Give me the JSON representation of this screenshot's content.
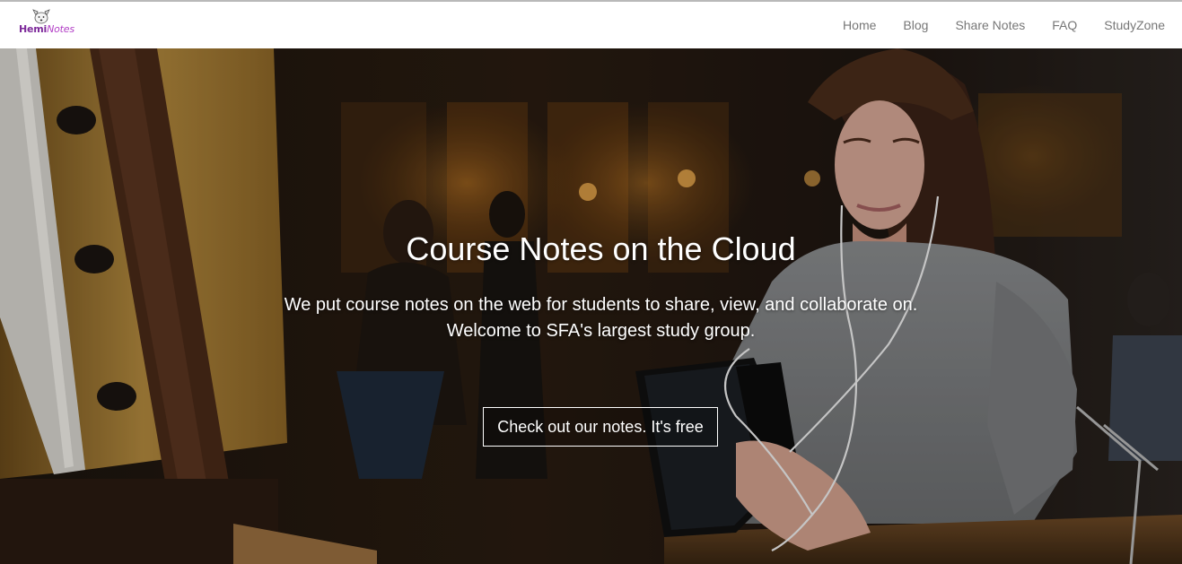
{
  "brand": {
    "logo_part1": "Hemi",
    "logo_part2": "Notes"
  },
  "nav": {
    "items": [
      {
        "label": "Home"
      },
      {
        "label": "Blog"
      },
      {
        "label": "Share Notes"
      },
      {
        "label": "FAQ"
      },
      {
        "label": "StudyZone"
      }
    ]
  },
  "hero": {
    "title": "Course Notes on the Cloud",
    "subtitle_line1": "We put course notes on the web for students to share, view, and collaborate on.",
    "subtitle_line2": "Welcome to SFA's largest study group.",
    "cta_label": "Check out our notes. It's free"
  },
  "colors": {
    "brand_purple": "#7d2a9a",
    "nav_text": "#777777",
    "hero_text": "#ffffff"
  }
}
